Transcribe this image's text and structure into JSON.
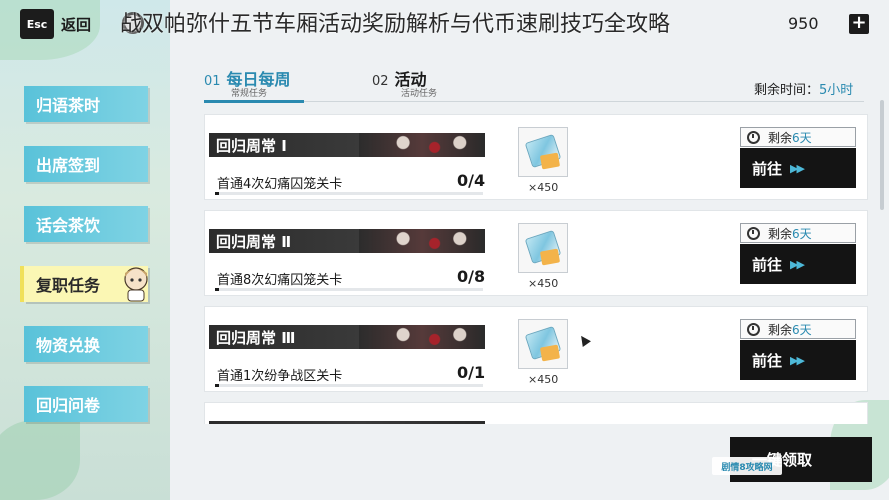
{
  "topbar": {
    "esc_label": "Esc",
    "back_label": "返回",
    "title_overlay": "战双帕弥什五节车厢活动奖励解析与代币速刷技巧全攻略",
    "currency_value": "950",
    "plus_label": "+"
  },
  "sidebar": {
    "items": [
      {
        "label": "归语茶时",
        "active": false
      },
      {
        "label": "出席签到",
        "active": false
      },
      {
        "label": "话会茶饮",
        "active": false
      },
      {
        "label": "复职任务",
        "active": true
      },
      {
        "label": "物资兑换",
        "active": false
      },
      {
        "label": "回归问卷",
        "active": false
      }
    ]
  },
  "tabs": [
    {
      "num": "01",
      "label": "每日每周",
      "sub": "常规任务"
    },
    {
      "num": "02",
      "label": "活动",
      "sub": "活动任务"
    }
  ],
  "remaining": {
    "label": "剩余时间：",
    "value": "5小时"
  },
  "tasks": [
    {
      "title": "回归周常 Ⅰ",
      "desc": "首通4次幻痛囚笼关卡",
      "progress": "0/4",
      "progress_ratio": 0,
      "reward_count": "×450",
      "time_prefix": "剩余",
      "time_value": "6天",
      "go_label": "前往",
      "go_arrows": "▶▶"
    },
    {
      "title": "回归周常 Ⅱ",
      "desc": "首通8次幻痛囚笼关卡",
      "progress": "0/8",
      "progress_ratio": 0,
      "reward_count": "×450",
      "time_prefix": "剩余",
      "time_value": "6天",
      "go_label": "前往",
      "go_arrows": "▶▶"
    },
    {
      "title": "回归周常 Ⅲ",
      "desc": "首通1次纷争战区关卡",
      "progress": "0/1",
      "progress_ratio": 0,
      "reward_count": "×450",
      "time_prefix": "剩余",
      "time_value": "6天",
      "go_label": "前往",
      "go_arrows": "▶▶"
    }
  ],
  "claim_all_label": "一键领取",
  "watermark": "剧情8攻略网",
  "colors": {
    "accent": "#2a8ab0",
    "sidebar": "#59c2d9",
    "active_sidebar": "#fbf7b4",
    "dark": "#141414"
  }
}
